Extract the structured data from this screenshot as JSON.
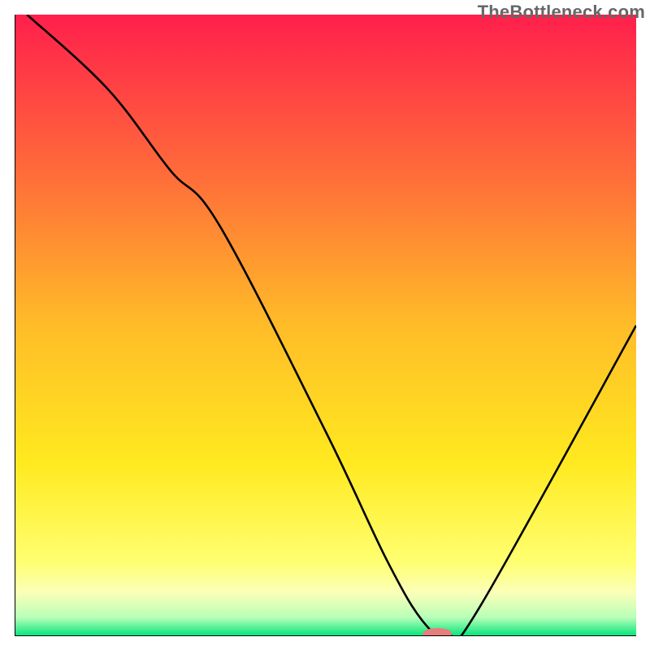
{
  "watermark": "TheBottleneck.com",
  "chart_data": {
    "type": "line",
    "title": "",
    "xlabel": "",
    "ylabel": "",
    "xlim": [
      0,
      100
    ],
    "ylim": [
      0,
      100
    ],
    "background_gradient": {
      "stops": [
        {
          "pos": 0.0,
          "color": "#ff1f4c"
        },
        {
          "pos": 0.25,
          "color": "#ff6a3a"
        },
        {
          "pos": 0.5,
          "color": "#ffbc28"
        },
        {
          "pos": 0.72,
          "color": "#ffe91f"
        },
        {
          "pos": 0.88,
          "color": "#ffff70"
        },
        {
          "pos": 0.93,
          "color": "#fbffb8"
        },
        {
          "pos": 0.97,
          "color": "#b8ffb8"
        },
        {
          "pos": 1.0,
          "color": "#00e47a"
        }
      ]
    },
    "series": [
      {
        "name": "curve",
        "x": [
          2,
          15,
          25,
          33,
          50,
          60,
          66,
          70,
          75,
          100
        ],
        "y": [
          100,
          88,
          75,
          66,
          33,
          12,
          2,
          0,
          5,
          50
        ]
      }
    ],
    "marker": {
      "x": 68,
      "y": 0,
      "color": "#e77d7d",
      "rx": 18,
      "ry": 7
    },
    "axes": {
      "color": "#000000",
      "width": 2
    }
  }
}
